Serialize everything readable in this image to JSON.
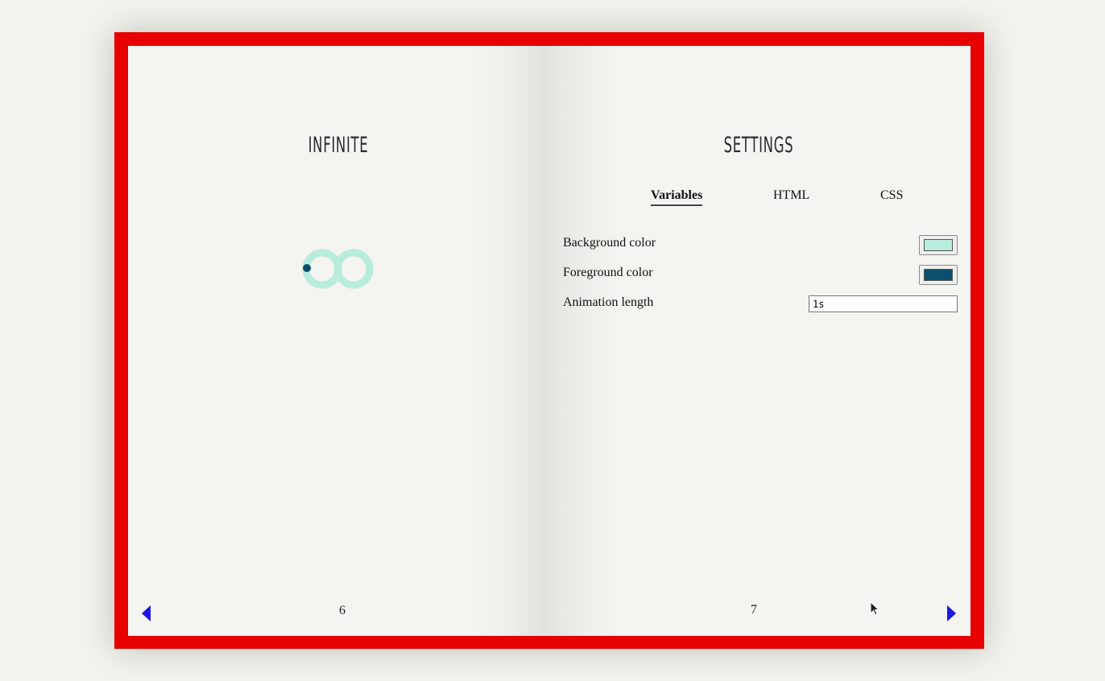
{
  "left_page": {
    "title": "Infinite",
    "page_number": "6",
    "loader": {
      "background_color": "#b8ecdc",
      "foreground_color": "#0a4f6e"
    }
  },
  "right_page": {
    "title": "Settings",
    "page_number": "7",
    "tabs": [
      {
        "label": "Variables",
        "active": true
      },
      {
        "label": "HTML",
        "active": false
      },
      {
        "label": "CSS",
        "active": false
      }
    ],
    "settings": {
      "background_color": {
        "label": "Background color",
        "value": "#b8ecdc"
      },
      "foreground_color": {
        "label": "Foreground color",
        "value": "#0a4f6e"
      },
      "animation_length": {
        "label": "Animation length",
        "value": "1s"
      }
    }
  },
  "navigation": {
    "prev_icon": "left-triangle-arrow",
    "next_icon": "right-triangle-arrow",
    "arrow_color": "#1a16e6"
  },
  "book": {
    "cover_color": "#e60000",
    "paper_color": "#f4f4f0"
  }
}
